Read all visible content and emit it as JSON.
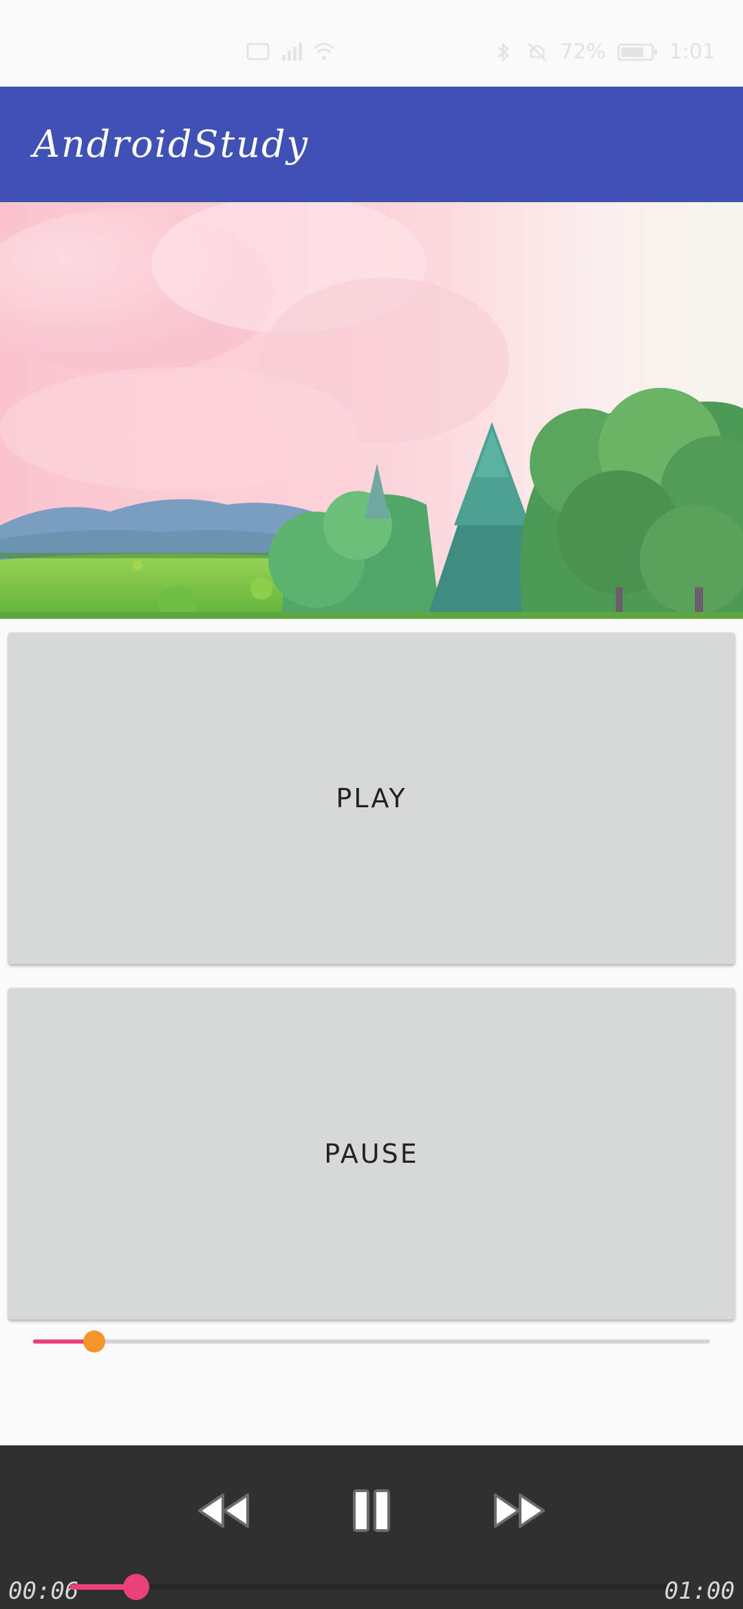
{
  "app_bar": {
    "title": "AndroidStudy",
    "color": "#3f51b5"
  },
  "status_bar": {
    "time": "1:01",
    "battery": "72%"
  },
  "video": {
    "scene": "landscape-video-frame"
  },
  "buttons": {
    "play_label": "PLAY",
    "pause_label": "PAUSE"
  },
  "seek_bar": {
    "progress": 0.09,
    "fill_color": "#ec407a",
    "thumb_color": "#f4952a"
  },
  "media_controller": {
    "current_time": "00:06",
    "total_time": "01:00",
    "progress": 0.11,
    "icons": [
      "rewind-icon",
      "pause-icon",
      "fast-forward-icon"
    ]
  }
}
